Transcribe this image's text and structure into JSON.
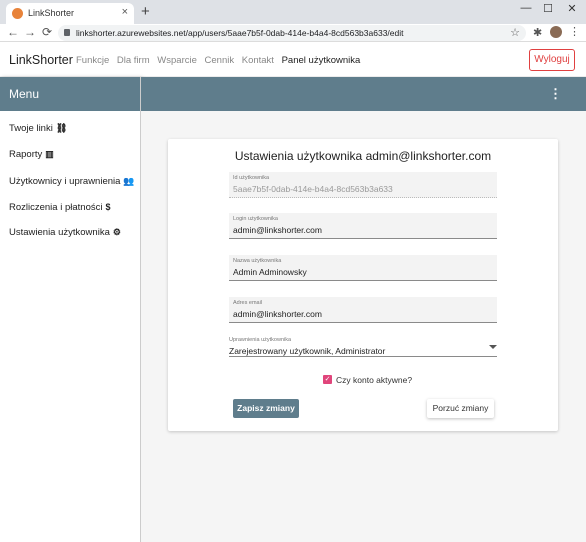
{
  "browser": {
    "tab_title": "LinkShorter",
    "tab_close": "×",
    "new_tab": "+",
    "url": "linkshorter.azurewebsites.net/app/users/5aae7b5f-0dab-414e-b4a4-8cd563b3a633/edit",
    "back": "←",
    "forward": "→",
    "reload": "⟳",
    "star": "☆",
    "extensions": "✱",
    "more": "⋮",
    "minimize": "—",
    "maximize": "☐",
    "close": "✕"
  },
  "header": {
    "brand": "LinkShorter",
    "nav": [
      "Funkcje",
      "Dla firm",
      "Wsparcie",
      "Cennik",
      "Kontakt",
      "Panel użytkownika"
    ],
    "logout": "Wyloguj"
  },
  "sidebar": {
    "title": "Menu",
    "items": [
      {
        "label": "Twoje linki",
        "icon": "link-icon",
        "glyph": "⛓"
      },
      {
        "label": "Raporty",
        "icon": "chart-icon",
        "glyph": "▥"
      },
      {
        "label": "Użytkownicy i uprawnienia",
        "icon": "users-icon",
        "glyph": "👥"
      },
      {
        "label": "Rozliczenia i płatności",
        "icon": "dollar-icon",
        "glyph": "$"
      },
      {
        "label": "Ustawienia użytkownika",
        "icon": "cogs-icon",
        "glyph": "⚙"
      }
    ]
  },
  "main": {
    "kebab": "⋮",
    "form": {
      "title": "Ustawienia użytkownika admin@linkshorter.com",
      "id_label": "Id użytkownika",
      "id_value": "5aae7b5f-0dab-414e-b4a4-8cd563b3a633",
      "login_label": "Login użytkownika",
      "login_value": "admin@linkshorter.com",
      "name_label": "Nazwa użytkownika",
      "name_value": "Admin Adminowsky",
      "email_label": "Adres email",
      "email_value": "admin@linkshorter.com",
      "roles_label": "Uprawnienia użytkownika",
      "roles_value": "Zarejestrowany użytkownik, Administrator",
      "active_label": "Czy konto aktywne?",
      "active_checked": true,
      "checkmark": "✓",
      "save": "Zapisz zmiany",
      "discard": "Porzuć zmiany"
    }
  },
  "colors": {
    "accent": "#5f7d8c",
    "danger": "#e04040",
    "checkbox": "#e0457b"
  }
}
